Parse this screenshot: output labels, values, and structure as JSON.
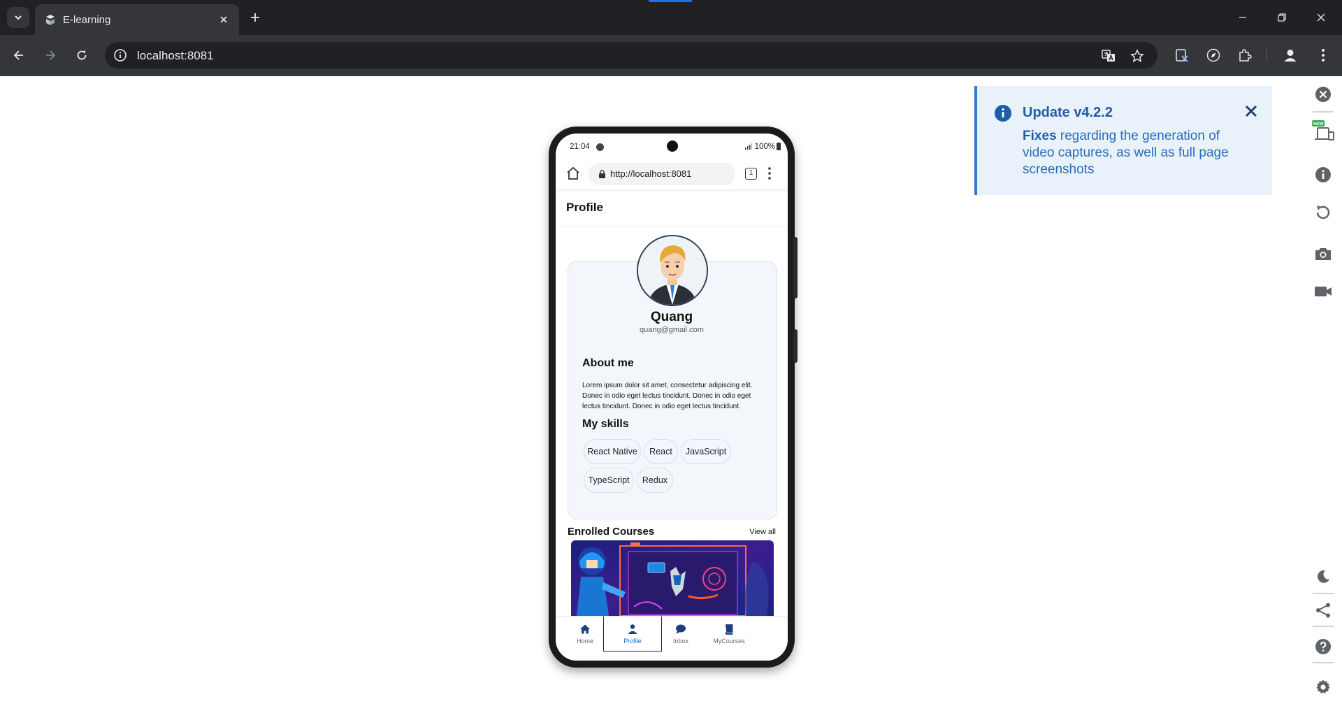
{
  "browser": {
    "tab_title": "E-learning",
    "url": "localhost:8081"
  },
  "notification": {
    "title": "Update v4.2.2",
    "body_bold": "Fixes",
    "body_rest": " regarding the generation of video captures, as well as full page screenshots"
  },
  "rail": {
    "new_badge": "NEW"
  },
  "phone": {
    "status": {
      "time": "21:04",
      "battery": "100%"
    },
    "url": "http://localhost:8081",
    "tab_count": "1",
    "header_title": "Profile",
    "profile": {
      "name": "Quang",
      "email": "quang@gmail.com",
      "about_title": "About me",
      "about_text": "Lorem ipsum dolor sit amet, consectetur adipiscing elit. Donec in odio eget lectus tincidunt. Donec in odio eget lectus tincidunt. Donec in odio eget lectus tincidunt.",
      "skills_title": "My skills",
      "skills": [
        "React Native",
        "React",
        "JavaScript",
        "TypeScript",
        "Redux"
      ]
    },
    "enrolled": {
      "title": "Enrolled Courses",
      "view_all": "View all"
    },
    "bottom_nav": [
      {
        "label": "Home",
        "icon": "home-icon"
      },
      {
        "label": "Profile",
        "icon": "person-icon",
        "active": true
      },
      {
        "label": "Inbox",
        "icon": "chat-icon"
      },
      {
        "label": "MyCourses",
        "icon": "book-icon"
      }
    ]
  },
  "colors": {
    "accent": "#1565c0",
    "notice_bg": "#e9f2fb",
    "notice_border": "#2f7bd0"
  }
}
